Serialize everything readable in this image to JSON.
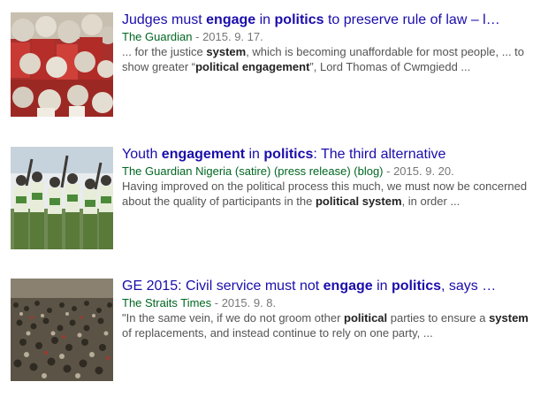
{
  "results": [
    {
      "title_parts": [
        {
          "t": "Judges must ",
          "b": false
        },
        {
          "t": "engage",
          "b": true
        },
        {
          "t": " in ",
          "b": false
        },
        {
          "t": "politics",
          "b": true
        },
        {
          "t": " to preserve rule of law – l…",
          "b": false
        }
      ],
      "source": "The Guardian",
      "date_sep": " - ",
      "date": "2015. 9. 17.",
      "snippet_parts": [
        {
          "t": "... for the justice ",
          "b": false
        },
        {
          "t": "system",
          "b": true
        },
        {
          "t": ", which is becoming unaffordable for most people, ... to show greater “",
          "b": false
        },
        {
          "t": "political engagement",
          "b": true
        },
        {
          "t": "”, Lord Thomas of Cwmgiedd ...",
          "b": false
        }
      ],
      "thumb_icon": "judges-in-wigs-photo"
    },
    {
      "title_parts": [
        {
          "t": "Youth ",
          "b": false
        },
        {
          "t": "engagement",
          "b": true
        },
        {
          "t": " in ",
          "b": false
        },
        {
          "t": "politics",
          "b": true
        },
        {
          "t": ": The third alternative",
          "b": false
        }
      ],
      "source": "The Guardian Nigeria (satire) (press release) (blog)",
      "date_sep": " - ",
      "date": "2015. 9. 20.",
      "snippet_parts": [
        {
          "t": "Having improved on the political process this much, we must now be concerned about the quality of participants in the ",
          "b": false
        },
        {
          "t": "political system",
          "b": true
        },
        {
          "t": ", in order ...",
          "b": false
        }
      ],
      "thumb_icon": "nysc-corps-members-photo"
    },
    {
      "title_parts": [
        {
          "t": "GE 2015: Civil service must not ",
          "b": false
        },
        {
          "t": "engage",
          "b": true
        },
        {
          "t": " in ",
          "b": false
        },
        {
          "t": "politics",
          "b": true
        },
        {
          "t": ", says …",
          "b": false
        }
      ],
      "source": "The Straits Times",
      "date_sep": " - ",
      "date": "2015. 9. 8.",
      "snippet_parts": [
        {
          "t": "\"In the same vein, if we do not groom other ",
          "b": false
        },
        {
          "t": "political",
          "b": true
        },
        {
          "t": " parties to ensure a ",
          "b": false
        },
        {
          "t": "system",
          "b": true
        },
        {
          "t": " of replacements, and instead continue to rely on one party, ...",
          "b": false
        }
      ],
      "thumb_icon": "rally-crowd-photo"
    }
  ]
}
